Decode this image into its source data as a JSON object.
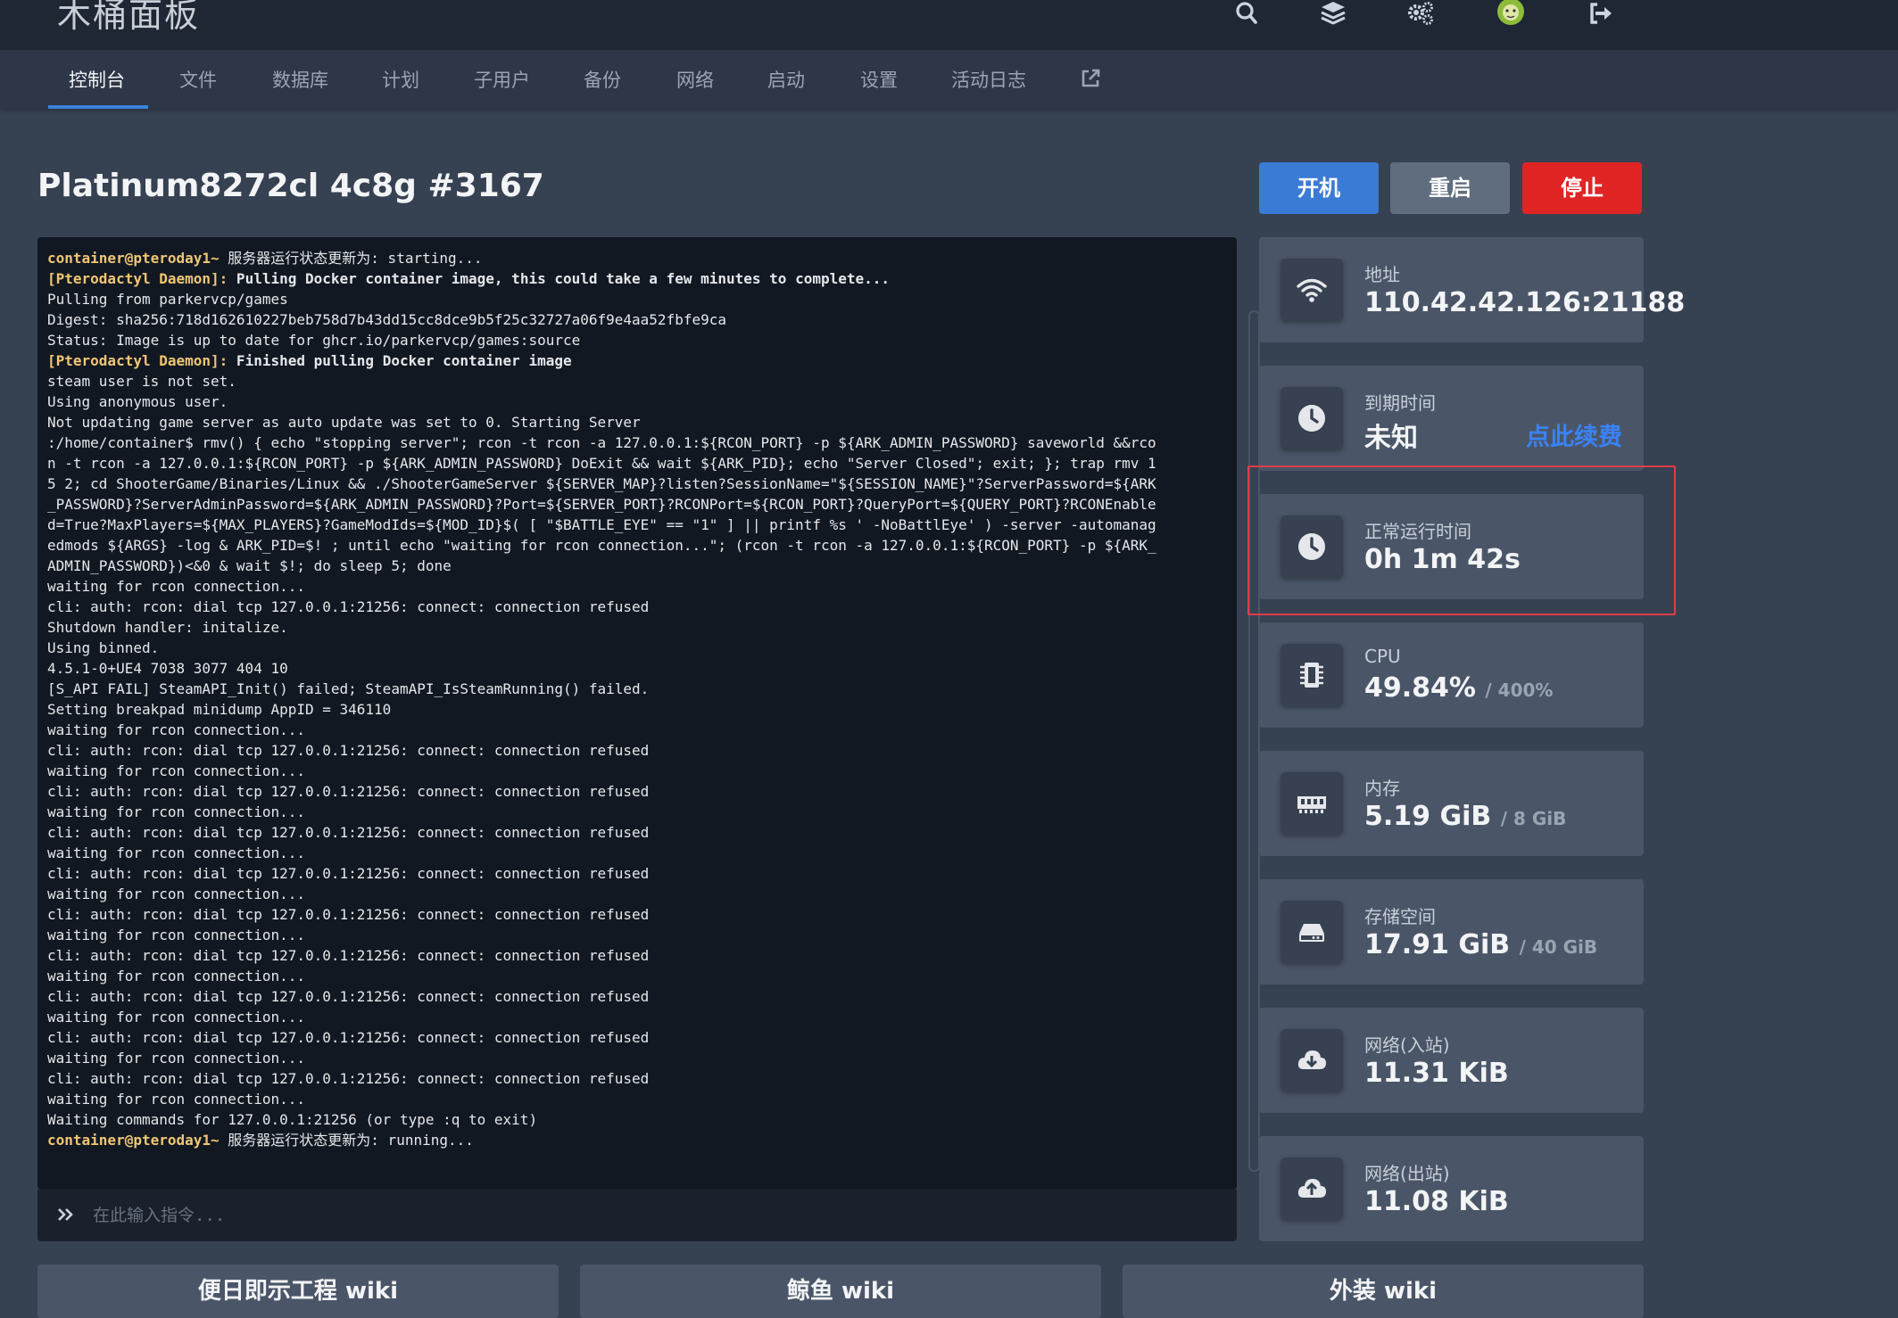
{
  "app": {
    "brand": "木桶面板"
  },
  "top_icons": [
    "search-icon",
    "layers-icon",
    "gears-icon",
    "avatar",
    "sign-out-icon"
  ],
  "tabs": [
    {
      "label": "控制台",
      "active": true
    },
    {
      "label": "文件"
    },
    {
      "label": "数据库"
    },
    {
      "label": "计划"
    },
    {
      "label": "子用户"
    },
    {
      "label": "备份"
    },
    {
      "label": "网络"
    },
    {
      "label": "启动"
    },
    {
      "label": "设置"
    },
    {
      "label": "活动日志"
    },
    {
      "label": "external-link-icon"
    }
  ],
  "server": {
    "title": "Platinum8272cl 4c8g #3167"
  },
  "power": {
    "start": "开机",
    "restart": "重启",
    "stop": "停止"
  },
  "console": {
    "input_placeholder": "在此输入指令...",
    "lines": [
      {
        "prefix": "container@pteroday1~",
        "prefix_type": "user",
        "text": " 服务器运行状态更新为: starting..."
      },
      {
        "prefix": "[Pterodactyl Daemon]:",
        "prefix_type": "daemon",
        "text": " Pulling Docker container image, this could take a few minutes to complete...",
        "bold": true
      },
      {
        "text": "Pulling from parkervcp/games"
      },
      {
        "text": "Digest: sha256:718d162610227beb758d7b43dd15cc8dce9b5f25c32727a06f9e4aa52fbfe9ca"
      },
      {
        "text": "Status: Image is up to date for ghcr.io/parkervcp/games:source"
      },
      {
        "prefix": "[Pterodactyl Daemon]:",
        "prefix_type": "daemon",
        "text": " Finished pulling Docker container image",
        "bold": true
      },
      {
        "text": "steam user is not set."
      },
      {
        "text": "Using anonymous user."
      },
      {
        "text": "Not updating game server as auto update was set to 0. Starting Server"
      },
      {
        "text": ":/home/container$ rmv() { echo \"stopping server\"; rcon -t rcon -a 127.0.0.1:${RCON_PORT} -p ${ARK_ADMIN_PASSWORD} saveworld &&rco"
      },
      {
        "text": "n -t rcon -a 127.0.0.1:${RCON_PORT} -p ${ARK_ADMIN_PASSWORD} DoExit && wait ${ARK_PID}; echo \"Server Closed\"; exit; }; trap rmv 1"
      },
      {
        "text": "5 2; cd ShooterGame/Binaries/Linux && ./ShooterGameServer ${SERVER_MAP}?listen?SessionName=\"${SESSION_NAME}\"?ServerPassword=${ARK"
      },
      {
        "text": "_PASSWORD}?ServerAdminPassword=${ARK_ADMIN_PASSWORD}?Port=${SERVER_PORT}?RCONPort=${RCON_PORT}?QueryPort=${QUERY_PORT}?RCONEnable"
      },
      {
        "text": "d=True?MaxPlayers=${MAX_PLAYERS}?GameModIds=${MOD_ID}$( [ \"$BATTLE_EYE\" == \"1\" ] || printf %s ' -NoBattlEye' ) -server -automanag"
      },
      {
        "text": "edmods ${ARGS} -log & ARK_PID=$! ; until echo \"waiting for rcon connection...\"; (rcon -t rcon -a 127.0.0.1:${RCON_PORT} -p ${ARK_"
      },
      {
        "text": "ADMIN_PASSWORD})<&0 & wait $!; do sleep 5; done"
      },
      {
        "text": "waiting for rcon connection..."
      },
      {
        "text": "cli: auth: rcon: dial tcp 127.0.0.1:21256: connect: connection refused"
      },
      {
        "text": "Shutdown handler: initalize."
      },
      {
        "text": "Using binned."
      },
      {
        "text": "4.5.1-0+UE4 7038 3077 404 10"
      },
      {
        "text": "[S_API FAIL] SteamAPI_Init() failed; SteamAPI_IsSteamRunning() failed."
      },
      {
        "text": "Setting breakpad minidump AppID = 346110"
      },
      {
        "text": "waiting for rcon connection..."
      },
      {
        "text": "cli: auth: rcon: dial tcp 127.0.0.1:21256: connect: connection refused"
      },
      {
        "text": "waiting for rcon connection..."
      },
      {
        "text": "cli: auth: rcon: dial tcp 127.0.0.1:21256: connect: connection refused"
      },
      {
        "text": "waiting for rcon connection..."
      },
      {
        "text": "cli: auth: rcon: dial tcp 127.0.0.1:21256: connect: connection refused"
      },
      {
        "text": "waiting for rcon connection..."
      },
      {
        "text": "cli: auth: rcon: dial tcp 127.0.0.1:21256: connect: connection refused"
      },
      {
        "text": "waiting for rcon connection..."
      },
      {
        "text": "cli: auth: rcon: dial tcp 127.0.0.1:21256: connect: connection refused"
      },
      {
        "text": "waiting for rcon connection..."
      },
      {
        "text": "cli: auth: rcon: dial tcp 127.0.0.1:21256: connect: connection refused"
      },
      {
        "text": "waiting for rcon connection..."
      },
      {
        "text": "cli: auth: rcon: dial tcp 127.0.0.1:21256: connect: connection refused"
      },
      {
        "text": "waiting for rcon connection..."
      },
      {
        "text": "cli: auth: rcon: dial tcp 127.0.0.1:21256: connect: connection refused"
      },
      {
        "text": "waiting for rcon connection..."
      },
      {
        "text": "cli: auth: rcon: dial tcp 127.0.0.1:21256: connect: connection refused"
      },
      {
        "text": "waiting for rcon connection..."
      },
      {
        "text": "Waiting commands for 127.0.0.1:21256 (or type :q to exit)"
      },
      {
        "prefix": "container@pteroday1~",
        "prefix_type": "user",
        "text": " 服务器运行状态更新为: running..."
      }
    ]
  },
  "stats": {
    "address": {
      "label": "地址",
      "value": "110.42.42.126:21188",
      "icon": "wifi-icon"
    },
    "expiry": {
      "label": "到期时间",
      "value": "未知",
      "renew": "点此续费",
      "icon": "clock-icon"
    },
    "uptime": {
      "label": "正常运行时间",
      "value": "0h 1m 42s",
      "icon": "clock-icon"
    },
    "cpu": {
      "label": "CPU",
      "value": "49.84%",
      "limit": "/ 400%",
      "icon": "microchip-icon"
    },
    "memory": {
      "label": "内存",
      "value": "5.19 GiB",
      "limit": "/ 8 GiB",
      "icon": "memory-icon"
    },
    "disk": {
      "label": "存储空间",
      "value": "17.91 GiB",
      "limit": "/ 40 GiB",
      "icon": "hdd-icon"
    },
    "net_in": {
      "label": "网络(入站)",
      "value": "11.31 KiB",
      "icon": "cloud-download-icon"
    },
    "net_out": {
      "label": "网络(出站)",
      "value": "11.08 KiB",
      "icon": "cloud-upload-icon"
    }
  },
  "wiki": {
    "btn1": "便日即示工程 wiki",
    "btn2": "鲸鱼 wiki",
    "btn3": "外装 wiki"
  },
  "colors": {
    "accent": "#3a7bd5",
    "stop": "#e02424",
    "restart": "#606d7e",
    "link": "#3b82f6",
    "highlight_border": "#e03c4a"
  }
}
